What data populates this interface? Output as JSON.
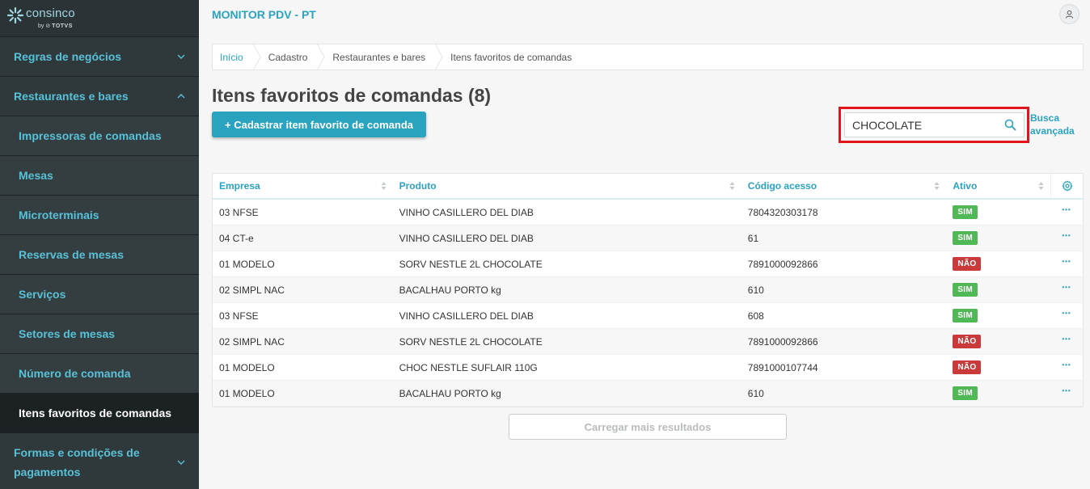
{
  "brand": {
    "name": "consinco",
    "by": "by",
    "partner": "TOTVS"
  },
  "app_title": "MONITOR PDV - PT",
  "sidebar": {
    "items": [
      {
        "label": "Regras de negócios",
        "level": "parent",
        "chevron": "down"
      },
      {
        "label": "Restaurantes e bares",
        "level": "parent",
        "chevron": "up"
      },
      {
        "label": "Impressoras de comandas",
        "level": "sub"
      },
      {
        "label": "Mesas",
        "level": "sub"
      },
      {
        "label": "Microterminais",
        "level": "sub"
      },
      {
        "label": "Reservas de mesas",
        "level": "sub"
      },
      {
        "label": "Serviços",
        "level": "sub"
      },
      {
        "label": "Setores de mesas",
        "level": "sub"
      },
      {
        "label": "Número de comanda",
        "level": "sub"
      },
      {
        "label": "Itens favoritos de comandas",
        "level": "sub",
        "active": true
      },
      {
        "label": "Formas e condições de pagamentos",
        "level": "parent",
        "chevron": "down"
      }
    ]
  },
  "breadcrumb": [
    "Início",
    "Cadastro",
    "Restaurantes e bares",
    "Itens favoritos de comandas"
  ],
  "page_title": "Itens favoritos de comandas (8)",
  "primary_button": "+ Cadastrar item favorito de comanda",
  "search": {
    "value": "CHOCOLATE",
    "advanced_label": "Busca avançada"
  },
  "table": {
    "columns": [
      "Empresa",
      "Produto",
      "Código acesso",
      "Ativo"
    ],
    "rows": [
      {
        "empresa": "03 NFSE",
        "produto": "VINHO CASILLERO DEL DIAB",
        "codigo": "7804320303178",
        "ativo": "SIM"
      },
      {
        "empresa": "04 CT-e",
        "produto": "VINHO CASILLERO DEL DIAB",
        "codigo": "61",
        "ativo": "SIM"
      },
      {
        "empresa": "01 MODELO",
        "produto": "SORV NESTLE 2L CHOCOLATE",
        "codigo": "7891000092866",
        "ativo": "NÃO"
      },
      {
        "empresa": "02 SIMPL NAC",
        "produto": "BACALHAU PORTO kg",
        "codigo": "610",
        "ativo": "SIM"
      },
      {
        "empresa": "03 NFSE",
        "produto": "VINHO CASILLERO DEL DIAB",
        "codigo": "608",
        "ativo": "SIM"
      },
      {
        "empresa": "02 SIMPL NAC",
        "produto": "SORV NESTLE 2L CHOCOLATE",
        "codigo": "7891000092866",
        "ativo": "NÃO"
      },
      {
        "empresa": "01 MODELO",
        "produto": "CHOC NESTLE SUFLAIR 110G",
        "codigo": "7891000107744",
        "ativo": "NÃO"
      },
      {
        "empresa": "01 MODELO",
        "produto": "BACALHAU PORTO kg",
        "codigo": "610",
        "ativo": "SIM"
      }
    ],
    "row_action_icon": "more-horizontal-icon",
    "settings_icon": "gear-icon"
  },
  "load_more": "Carregar mais resultados",
  "colors": {
    "accent": "#2aa3c0",
    "sidebar": "#2b3336",
    "yes": "#50b856",
    "no": "#cb3a3a",
    "highlight": "#e0161c"
  }
}
